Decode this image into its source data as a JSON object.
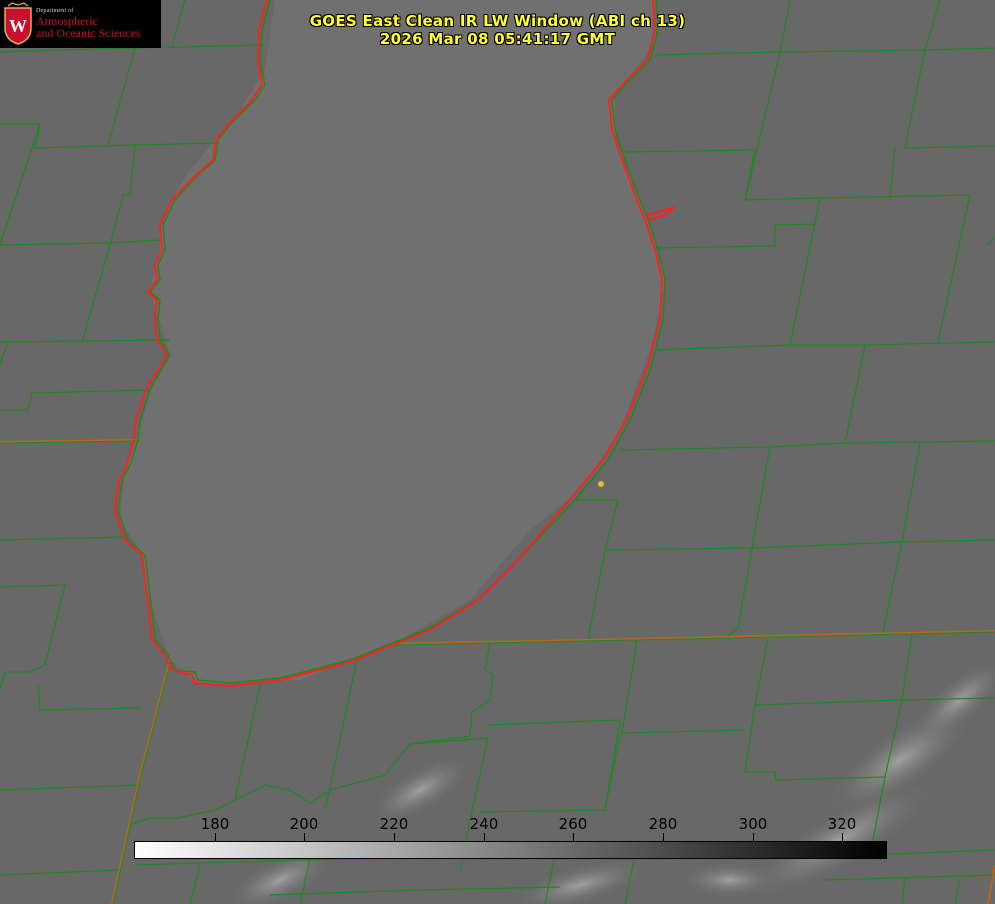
{
  "title": {
    "line1": "GOES East Clean IR LW Window (ABI ch 13)",
    "line2": "2026 Mar 08 05:41:17 GMT"
  },
  "logo": {
    "department": "Department of",
    "line1": "Atmospheric",
    "line2": "and Oceanic Sciences",
    "seal_letter": "W",
    "brand_color": "#c8102e"
  },
  "colorbar": {
    "min": 162,
    "max": 330,
    "ticks": [
      180,
      200,
      220,
      240,
      260,
      280,
      300,
      320
    ],
    "colors": [
      "#ffffff",
      "#000000"
    ]
  },
  "colors": {
    "title": "#ffff33",
    "lakeshore": "#ff2020",
    "county_lines": "#1f8a1f",
    "state_lines": "#b5651d",
    "station_dot": "#e0c020",
    "background": "#686868"
  }
}
